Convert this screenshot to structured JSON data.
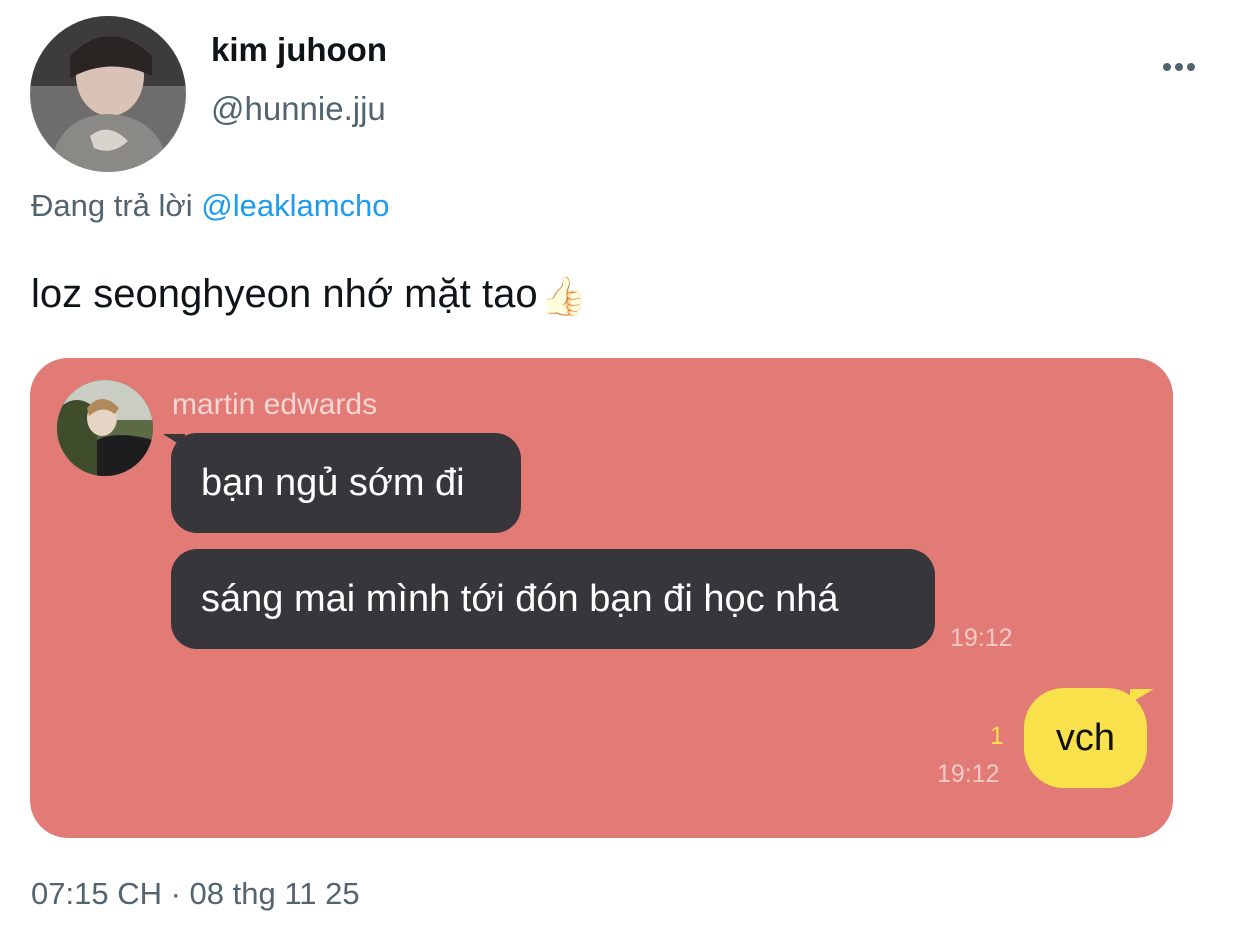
{
  "author": {
    "display_name": "kim juhoon",
    "handle": "@hunnie.jju"
  },
  "reply": {
    "prefix": "Đang trả lời",
    "mention": "@leaklamcho"
  },
  "tweet": {
    "text": "loz seonghyeon nhớ mặt tao",
    "emoji": "👍🏻"
  },
  "chat": {
    "sender_name": "martin edwards",
    "messages": [
      {
        "text": "bạn ngủ sớm đi"
      },
      {
        "text": "sáng mai mình tới đón bạn đi học nhá",
        "time": "19:12"
      }
    ],
    "reply": {
      "text": "vch",
      "unread_count": "1",
      "time": "19:12"
    },
    "colors": {
      "background": "#e27a76",
      "incoming_bubble": "#37363b",
      "outgoing_bubble": "#f8e14b"
    }
  },
  "footer": {
    "timestamp": "07:15 CH · 08 thg 11 25"
  },
  "icons": {
    "more": "more-horizontal-icon"
  }
}
